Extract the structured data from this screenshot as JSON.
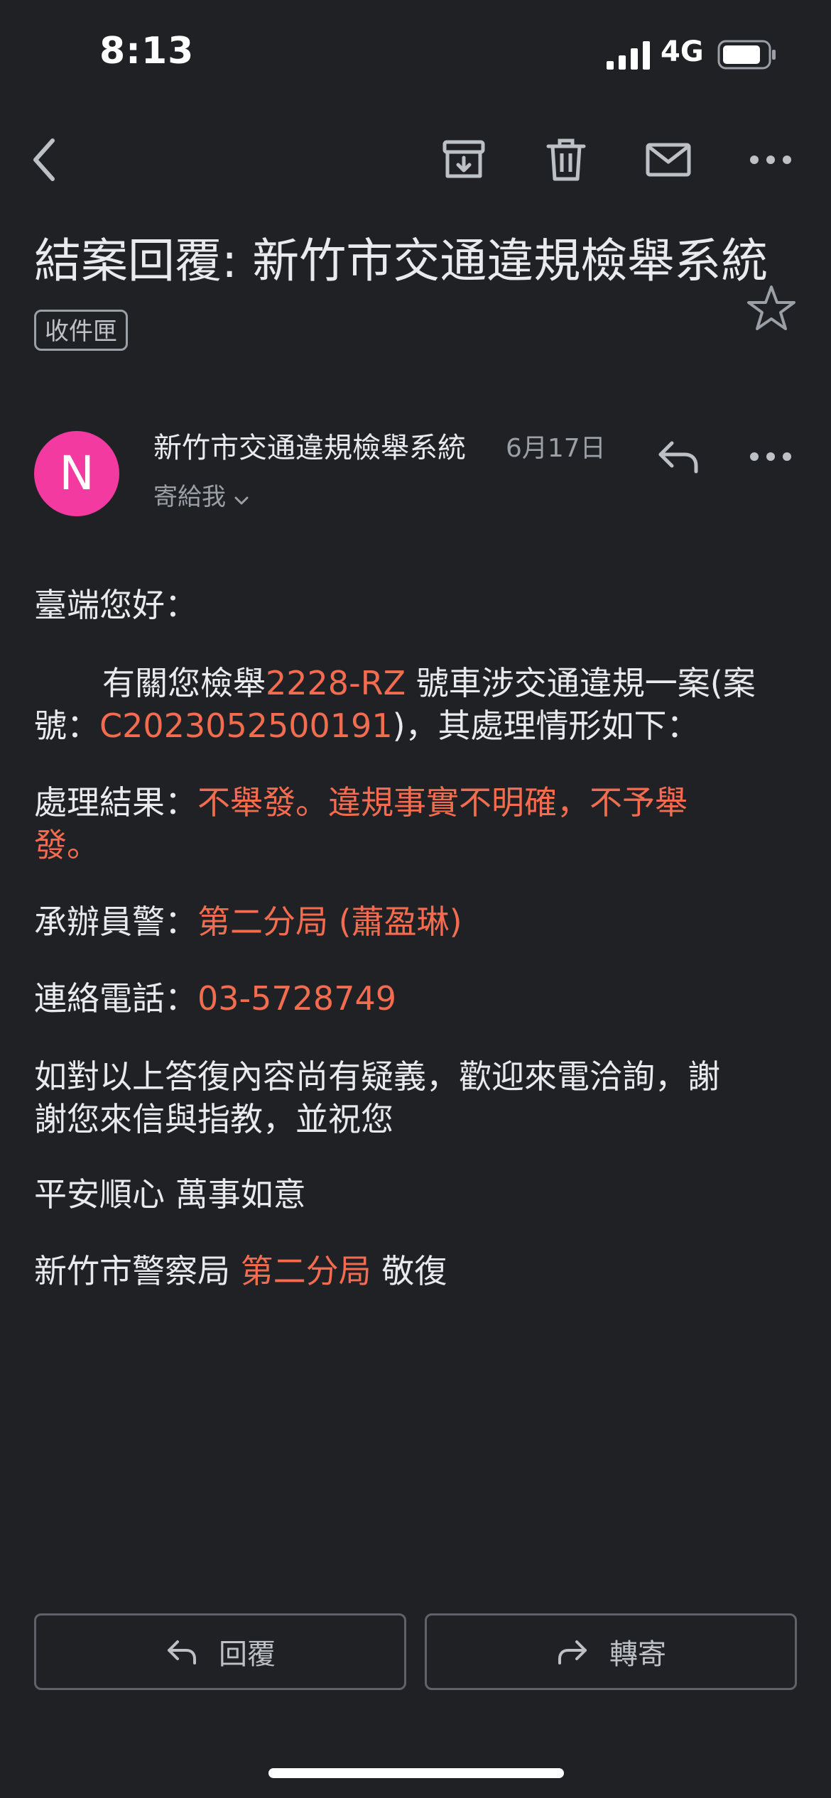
{
  "status_bar": {
    "time": "8:13",
    "network": "4G",
    "icons": [
      "signal-icon",
      "battery-icon"
    ]
  },
  "toolbar": {
    "icons": [
      "back-icon",
      "archive-icon",
      "delete-icon",
      "mark-unread-icon",
      "more-icon"
    ]
  },
  "email": {
    "subject": "結案回覆: 新竹市交通違規檢舉系統",
    "label": "收件匣",
    "sender": {
      "avatar_letter": "N",
      "avatar_color": "#f23aa0",
      "name": "新竹市交通違規檢舉系統",
      "date": "6月17日",
      "recipient": "寄給我"
    },
    "body": {
      "greeting": "臺端您好：",
      "p1_a": "有關您檢舉",
      "p1_plate": "2228-RZ",
      "p1_b": " 號車涉交通違規一案(案",
      "p1_c": "號：",
      "p1_case": "C2023052500191",
      "p1_d": ")，其處理情形如下：",
      "result_label": "處理結果：",
      "result_value_1": "不舉發。違規事實不明確，不予舉",
      "result_value_2": "發。",
      "officer_label": "承辦員警：",
      "officer_value": "第二分局 (蕭盈琳)",
      "phone_label": "連絡電話：",
      "phone_value": "03-5728749",
      "closing_1": "如對以上答復內容尚有疑義，歡迎來電洽詢，謝",
      "closing_2": "謝您來信與指教，並祝您",
      "wish": "平安順心 萬事如意",
      "sign_a": "新竹市警察局 ",
      "sign_unit": "第二分局",
      "sign_b": " 敬復"
    }
  },
  "actions": {
    "reply": "回覆",
    "forward": "轉寄"
  },
  "colors": {
    "background": "#202124",
    "highlight": "#f36c50"
  }
}
